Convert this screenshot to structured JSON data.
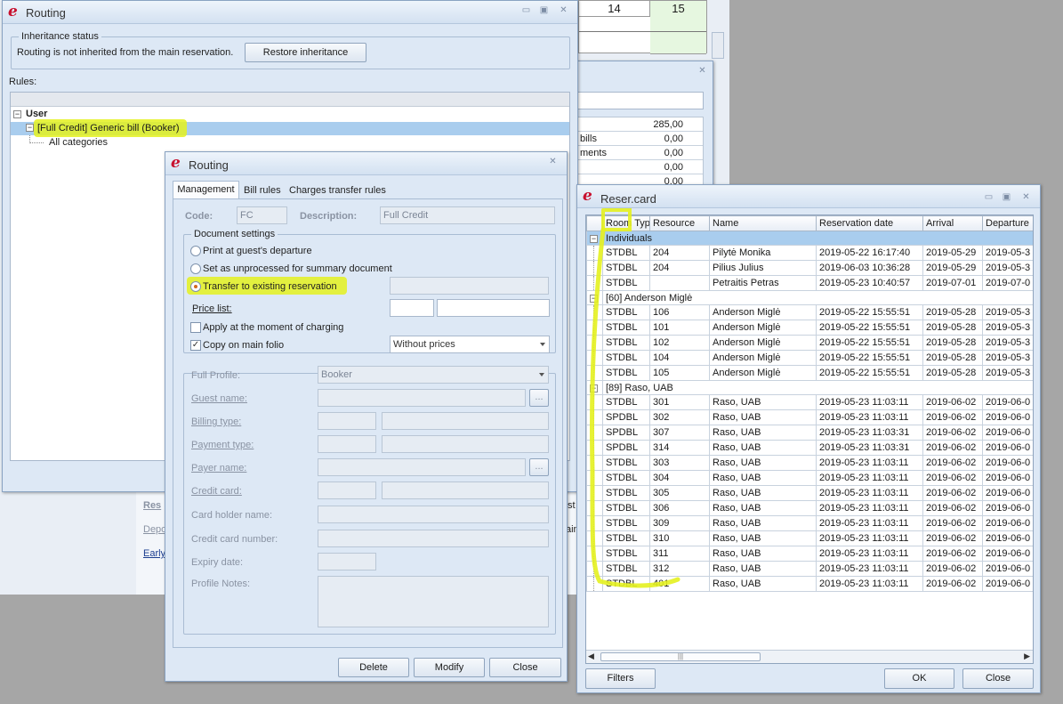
{
  "bg": {
    "col14": "14",
    "col15": "15",
    "sums": [
      "285,00",
      "0,00",
      "0,00",
      "0,00",
      "0,00"
    ],
    "side_labels": [
      "bills",
      "ments"
    ],
    "ellipsis": "...",
    "res_label": "Res",
    "dep_label": "Depo",
    "early_label": "Early",
    "st_label": "st",
    "ain_label": "ain"
  },
  "routing_main": {
    "title": "Routing",
    "inheritance": {
      "group_title": "Inheritance status",
      "message": "Routing is not inherited from the main reservation.",
      "restore_button": "Restore inheritance"
    },
    "rules_label": "Rules:",
    "tree": {
      "root": "User",
      "child": "[Full Credit] Generic bill (Booker)",
      "leaf": "All categories"
    }
  },
  "routing_dialog": {
    "title": "Routing",
    "tabs": [
      "Management",
      "Bill rules",
      "Charges transfer rules"
    ],
    "code_label": "Code:",
    "code_value": "FC",
    "description_label": "Description:",
    "description_value": "Full Credit",
    "doc_settings_title": "Document settings",
    "options": {
      "print": "Print at guest's departure",
      "unprocessed": "Set as unprocessed for summary document",
      "transfer": "Transfer to existing reservation"
    },
    "price_list_label": "Price list:",
    "apply_charging": "Apply at the moment of charging",
    "copy_main_folio": "Copy on main folio",
    "copy_select_value": "Without prices",
    "full_profile_label": "Full Profile:",
    "full_profile_value": "Booker",
    "guest_name_label": "Guest name:",
    "billing_type_label": "Billing type:",
    "payment_type_label": "Payment type:",
    "payer_name_label": "Payer name:",
    "credit_card_label": "Credit card:",
    "card_holder_label": "Card holder name:",
    "card_number_label": "Credit card number:",
    "expiry_label": "Expiry date:",
    "profile_notes_label": "Profile Notes:",
    "ellipsis": "...",
    "buttons": {
      "delete": "Delete",
      "modify": "Modify",
      "close": "Close"
    }
  },
  "reser_card": {
    "title": "Reser.card",
    "columns": [
      "Room Typ",
      "Resource",
      "Name",
      "Reservation date",
      "Arrival",
      "Departure"
    ],
    "groups": [
      {
        "label": "Individuals",
        "rows": [
          [
            "STDBL",
            "204",
            "Pilytė Monika",
            "2019-05-22 16:17:40",
            "2019-05-29",
            "2019-05-3"
          ],
          [
            "STDBL",
            "204",
            "Pilius Julius",
            "2019-06-03 10:36:28",
            "2019-05-29",
            "2019-05-3"
          ],
          [
            "STDBL",
            "",
            "Petraitis Petras",
            "2019-05-23 10:40:57",
            "2019-07-01",
            "2019-07-0"
          ]
        ]
      },
      {
        "label": "[60] Anderson Miglė",
        "rows": [
          [
            "STDBL",
            "106",
            "Anderson Miglė",
            "2019-05-22 15:55:51",
            "2019-05-28",
            "2019-05-3"
          ],
          [
            "STDBL",
            "101",
            "Anderson Miglė",
            "2019-05-22 15:55:51",
            "2019-05-28",
            "2019-05-3"
          ],
          [
            "STDBL",
            "102",
            "Anderson Miglė",
            "2019-05-22 15:55:51",
            "2019-05-28",
            "2019-05-3"
          ],
          [
            "STDBL",
            "104",
            "Anderson Miglė",
            "2019-05-22 15:55:51",
            "2019-05-28",
            "2019-05-3"
          ],
          [
            "STDBL",
            "105",
            "Anderson Miglė",
            "2019-05-22 15:55:51",
            "2019-05-28",
            "2019-05-3"
          ]
        ]
      },
      {
        "label": "[89] Raso, UAB",
        "rows": [
          [
            "STDBL",
            "301",
            "Raso, UAB",
            "2019-05-23 11:03:11",
            "2019-06-02",
            "2019-06-0"
          ],
          [
            "SPDBL",
            "302",
            "Raso, UAB",
            "2019-05-23 11:03:11",
            "2019-06-02",
            "2019-06-0"
          ],
          [
            "SPDBL",
            "307",
            "Raso, UAB",
            "2019-05-23 11:03:31",
            "2019-06-02",
            "2019-06-0"
          ],
          [
            "SPDBL",
            "314",
            "Raso, UAB",
            "2019-05-23 11:03:31",
            "2019-06-02",
            "2019-06-0"
          ],
          [
            "STDBL",
            "303",
            "Raso, UAB",
            "2019-05-23 11:03:11",
            "2019-06-02",
            "2019-06-0"
          ],
          [
            "STDBL",
            "304",
            "Raso, UAB",
            "2019-05-23 11:03:11",
            "2019-06-02",
            "2019-06-0"
          ],
          [
            "STDBL",
            "305",
            "Raso, UAB",
            "2019-05-23 11:03:11",
            "2019-06-02",
            "2019-06-0"
          ],
          [
            "STDBL",
            "306",
            "Raso, UAB",
            "2019-05-23 11:03:11",
            "2019-06-02",
            "2019-06-0"
          ],
          [
            "STDBL",
            "309",
            "Raso, UAB",
            "2019-05-23 11:03:11",
            "2019-06-02",
            "2019-06-0"
          ],
          [
            "STDBL",
            "310",
            "Raso, UAB",
            "2019-05-23 11:03:11",
            "2019-06-02",
            "2019-06-0"
          ],
          [
            "STDBL",
            "311",
            "Raso, UAB",
            "2019-05-23 11:03:11",
            "2019-06-02",
            "2019-06-0"
          ],
          [
            "STDBL",
            "312",
            "Raso, UAB",
            "2019-05-23 11:03:11",
            "2019-06-02",
            "2019-06-0"
          ],
          [
            "STDBL",
            "401",
            "Raso, UAB",
            "2019-05-23 11:03:11",
            "2019-06-02",
            "2019-06-0"
          ]
        ]
      }
    ],
    "buttons": {
      "filters": "Filters",
      "ok": "OK",
      "close": "Close"
    }
  },
  "colors": {
    "accent": "#c8102e",
    "highlight": "#e4f11f",
    "selection": "#a9cdee",
    "window_bg": "#dde8f5"
  }
}
